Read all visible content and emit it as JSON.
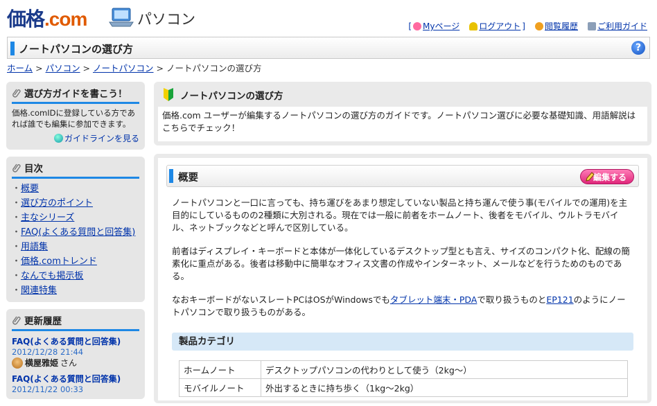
{
  "header": {
    "logo_main": "価格",
    "logo_dot": ".com",
    "section_label": "パソコン"
  },
  "topnav": [
    {
      "label": "Myページ",
      "prefix": "[",
      "icon": "my-page-icon"
    },
    {
      "label": "ログアウト",
      "suffix": "]",
      "icon": "key-icon"
    },
    {
      "label": "閲覧履歴",
      "icon": "history-icon"
    },
    {
      "label": "ご利用ガイド",
      "icon": "guide-icon"
    }
  ],
  "page_title": "ノートパソコンの選び方",
  "help_label": "?",
  "breadcrumb": [
    "ホーム",
    "パソコン",
    "ノートパソコン",
    "ノートパソコンの選び方"
  ],
  "sidebar": {
    "write_guide": {
      "title": "選び方ガイドを書こう！",
      "text": "価格.comIDに登録している方であれば誰でも編集に参加できます。",
      "link": "ガイドラインを見る"
    },
    "toc": {
      "title": "目次",
      "items": [
        "概要",
        "選び方のポイント",
        "主なシリーズ",
        "FAQ(よくある質問と回答集)",
        "用語集",
        "価格.comトレンド",
        "なんでも掲示板",
        "関連特集"
      ]
    },
    "history": {
      "title": "更新履歴",
      "entries": [
        {
          "title": "FAQ(よくある質問と回答集)",
          "date": "2012/12/28 21:44",
          "user": "横屋雅姫",
          "suffix": "さん"
        },
        {
          "title": "FAQ(よくある質問と回答集)",
          "date": "2012/11/22 00:33"
        }
      ]
    }
  },
  "intro": {
    "title": "ノートパソコンの選び方",
    "text": "価格.com ユーザーが編集するノートパソコンの選び方のガイドです。ノートパソコン選びに必要な基礎知識、用語解説はこちらでチェック！"
  },
  "overview": {
    "title": "概要",
    "edit_label": "編集する",
    "para1": "ノートパソコンと一口に言っても、持ち運びをあまり想定していない製品と持ち運んで使う事(モバイルでの運用)を主目的にしているものの2種類に大別される。現在では一般に前者をホームノート、後者をモバイル、ウルトラモバイル、ネットブックなどと呼んで区別している。",
    "para2": "前者はディスプレイ・キーボードと本体が一体化しているデスクトップ型とも言え、サイズのコンパクト化、配線の簡素化に重点がある。後者は移動中に簡単なオフィス文書の作成やインターネット、メールなどを行うためのものである。",
    "para3_a": "なおキーボードがないスレートPCはOSがWindowsでも",
    "para3_link1": "タブレット端末・PDA",
    "para3_b": "で取り扱うものと",
    "para3_link2": "EP121",
    "para3_c": "のようにノートパソコンで取り扱うものがある。",
    "category_title": "製品カテゴリ",
    "categories": [
      {
        "name": "ホームノート",
        "desc": "デスクトップパソコンの代わりとして使う（2kg～）"
      },
      {
        "name": "モバイルノート",
        "desc": "外出するときに持ち歩く（1kg～2kg）"
      }
    ]
  }
}
